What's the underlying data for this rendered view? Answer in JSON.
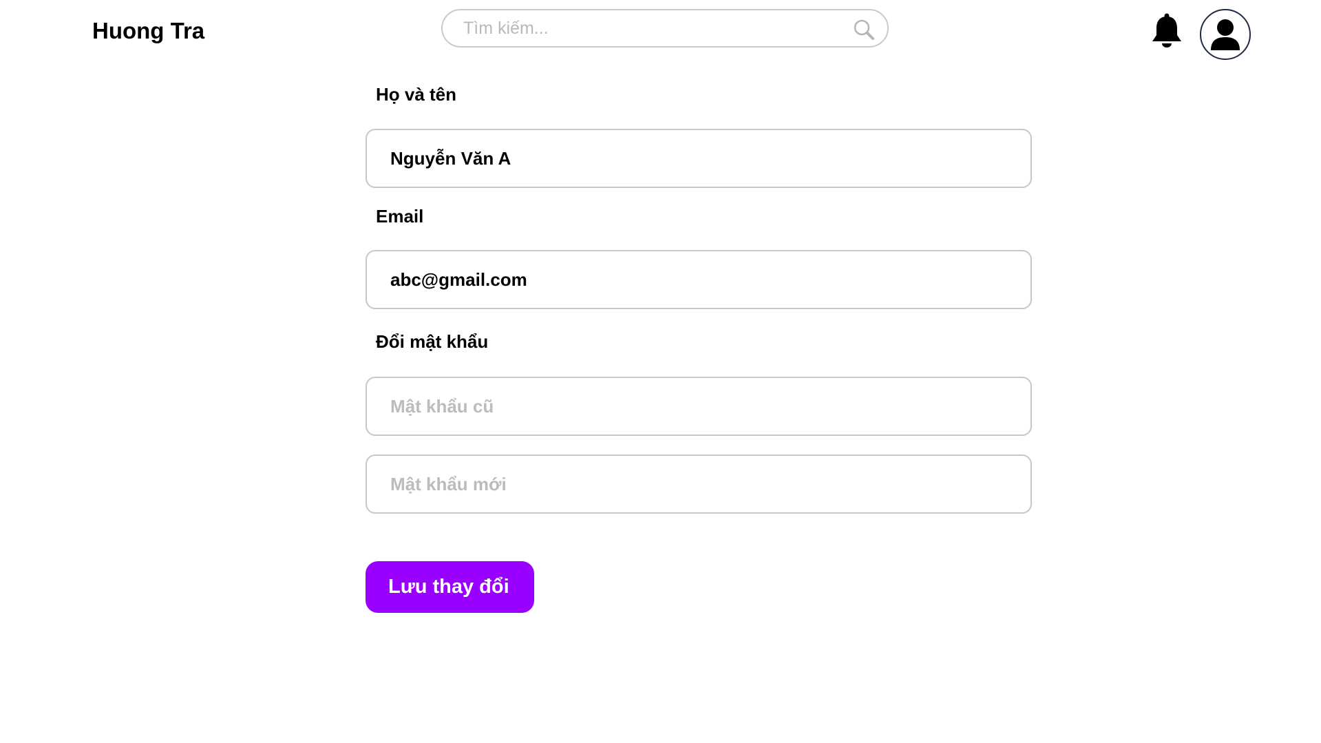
{
  "header": {
    "brand": "Huong Tra",
    "search_placeholder": "Tìm kiếm...",
    "icons": {
      "search": "search-icon",
      "notifications": "bell-icon",
      "profile": "user-avatar-icon"
    }
  },
  "form": {
    "fullname": {
      "label": "Họ và tên",
      "value": "Nguyễn Văn A"
    },
    "email": {
      "label": "Email",
      "value": "abc@gmail.com"
    },
    "password": {
      "label": "Đổi mật khẩu",
      "old_placeholder": "Mật khẩu cũ",
      "new_placeholder": "Mật khẩu mới"
    },
    "save_label": "Lưu thay đổi"
  },
  "colors": {
    "accent": "#9900ff",
    "field_border": "#c7c7c7",
    "placeholder": "#bcbcbc",
    "avatar_border": "#1f2a44"
  }
}
